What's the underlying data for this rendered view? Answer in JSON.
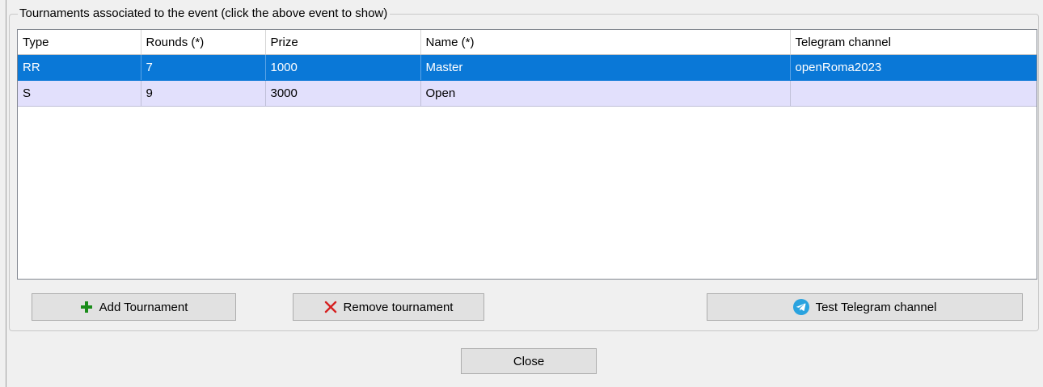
{
  "group": {
    "title": "Tournaments associated to the event (click the above event to show)"
  },
  "table": {
    "columns": [
      "Type",
      "Rounds (*)",
      "Prize",
      "Name (*)",
      "Telegram channel"
    ],
    "rows": [
      {
        "type": "RR",
        "rounds": "7",
        "prize": "1000",
        "name": "Master",
        "telegram": "openRoma2023",
        "selected": true
      },
      {
        "type": "S",
        "rounds": "9",
        "prize": "3000",
        "name": "Open",
        "telegram": "",
        "selected": false
      }
    ]
  },
  "buttons": {
    "add": {
      "label": "Add Tournament",
      "icon": "plus-icon"
    },
    "remove": {
      "label": "Remove tournament",
      "icon": "x-icon"
    },
    "telegram": {
      "label": "Test Telegram channel",
      "icon": "telegram-icon"
    },
    "close": {
      "label": "Close"
    }
  },
  "colors": {
    "selected_row": "#0a78d7",
    "row_background": "#e2e0fc",
    "plus_icon": "#1a8c1a",
    "x_icon": "#d62020",
    "telegram_icon": "#2aa3df"
  }
}
